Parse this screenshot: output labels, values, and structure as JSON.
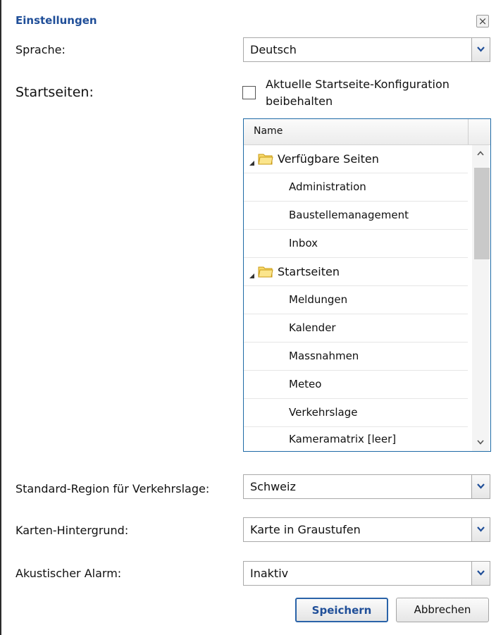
{
  "dialog": {
    "title": "Einstellungen",
    "close_symbol": "×"
  },
  "language": {
    "label": "Sprache:",
    "value": "Deutsch"
  },
  "startpages": {
    "label": "Startseiten:",
    "keep_config_label": "Aktuelle Startseite-Konfiguration beibehalten",
    "keep_config_checked": false,
    "tree": {
      "column_header": "Name",
      "groups": [
        {
          "label": "Verfügbare Seiten",
          "items": [
            "Administration",
            "Baustellemanagement",
            "Inbox"
          ]
        },
        {
          "label": "Startseiten",
          "items": [
            "Meldungen",
            "Kalender",
            "Massnahmen",
            "Meteo",
            "Verkehrslage",
            "Kameramatrix [leer]"
          ]
        }
      ]
    }
  },
  "region": {
    "label": "Standard-Region für Verkehrslage:",
    "value": "Schweiz"
  },
  "map_background": {
    "label": "Karten-Hintergrund:",
    "value": "Karte in Graustufen"
  },
  "alarm": {
    "label": "Akustischer Alarm:",
    "value": "Inaktiv"
  },
  "buttons": {
    "save": "Speichern",
    "cancel": "Abbrechen"
  },
  "icons": {
    "dropdown": "chevron-down-icon",
    "expander": "triangle-expanded-icon",
    "folder": "folder-icon",
    "scroll_up": "chevron-up-icon",
    "scroll_down": "chevron-down-icon"
  },
  "colors": {
    "title": "#1f4e98",
    "tree_border": "#1e6aa6",
    "folder": "#f0c419"
  }
}
